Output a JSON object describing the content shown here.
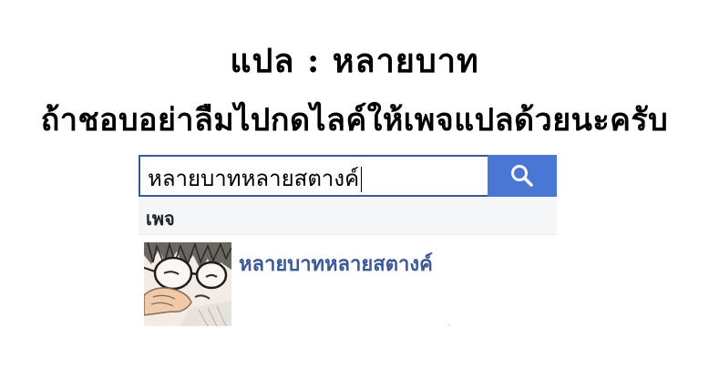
{
  "header": {
    "translator_line": "แปล : หลายบาท",
    "request_line": "ถ้าชอบอย่าลืมไปกดไลค์ให้เพจแปลด้วยนะครับ"
  },
  "search": {
    "value": "หลายบาทหลายสตางค์",
    "button_icon": "search-icon"
  },
  "results": {
    "section_label": "เพจ",
    "items": [
      {
        "name": "หลายบาทหลายสตางค์",
        "thumbnail": "manga-avatar-image"
      }
    ]
  },
  "colors": {
    "brand_blue": "#3b5998",
    "button_blue": "#4a77d4",
    "header_bg": "#f5f6f7"
  }
}
